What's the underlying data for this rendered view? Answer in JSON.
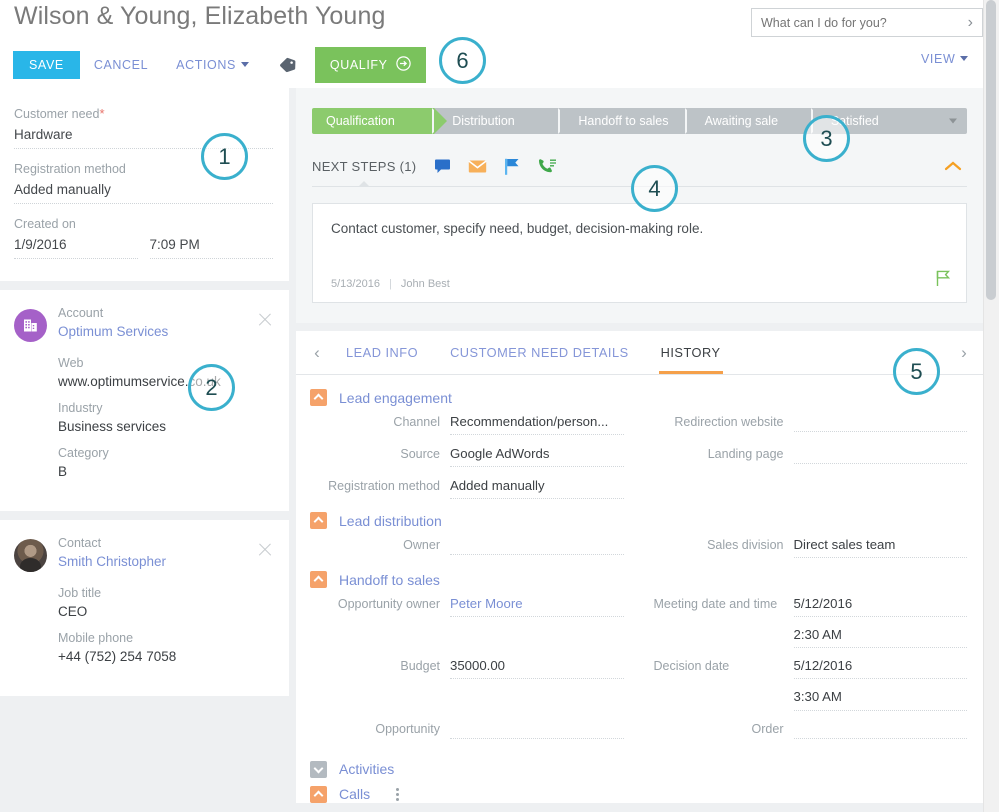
{
  "header": {
    "title": "Wilson & Young, Elizabeth Young",
    "save_label": "SAVE",
    "cancel_label": "CANCEL",
    "actions_label": "ACTIONS",
    "tag_icon": "tag-icon",
    "qualify_label": "QUALIFY",
    "view_label": "VIEW",
    "search_placeholder": "What can I do for you?",
    "search_value": ""
  },
  "left": {
    "need_card": {
      "customer_need_label": "Customer need",
      "customer_need_required": "*",
      "customer_need_value": "Hardware",
      "registration_method_label": "Registration method",
      "registration_method_value": "Added manually",
      "created_on_label": "Created on",
      "created_on_date": "1/9/2016",
      "created_on_time": "7:09 PM"
    },
    "account_card": {
      "label": "Account",
      "name": "Optimum Services",
      "icon": "building-icon",
      "close_icon": "close-icon",
      "fields": [
        {
          "label": "Web",
          "value": "www.optimumservice.co.uk"
        },
        {
          "label": "Industry",
          "value": "Business services"
        },
        {
          "label": "Category",
          "value": "B"
        }
      ]
    },
    "contact_card": {
      "label": "Contact",
      "name": "Smith Christopher",
      "icon": "avatar-photo",
      "close_icon": "close-icon",
      "fields": [
        {
          "label": "Job title",
          "value": "CEO"
        },
        {
          "label": "Mobile phone",
          "value": "+44 (752) 254 7058"
        }
      ]
    }
  },
  "stages": {
    "items": [
      {
        "label": "Qualification",
        "active": true
      },
      {
        "label": "Distribution",
        "active": false
      },
      {
        "label": "Handoff to sales",
        "active": false
      },
      {
        "label": "Awaiting sale",
        "active": false
      },
      {
        "label": "Satisfied",
        "active": false
      }
    ],
    "active_color": "#8ccb6d",
    "inactive_color": "#bdc3c7"
  },
  "next_steps": {
    "title": "NEXT STEPS (1)",
    "icons": [
      "comment-icon",
      "email-icon",
      "flag-icon",
      "call-icon"
    ],
    "collapse_icon": "chevron-up-icon",
    "card": {
      "text": "Contact customer, specify need, budget, decision-making role.",
      "date": "5/13/2016",
      "author": "John Best",
      "flag_icon": "flag-outline-icon"
    }
  },
  "tabs": {
    "prev_icon": "chevron-left-icon",
    "next_icon": "chevron-right-icon",
    "items": [
      {
        "label": "LEAD INFO",
        "active": false
      },
      {
        "label": "CUSTOMER NEED DETAILS",
        "active": false
      },
      {
        "label": "HISTORY",
        "active": true
      }
    ],
    "active_underline_color": "#f5a04a"
  },
  "sections": [
    {
      "id": "lead-engagement",
      "title": "Lead engagement",
      "toggle": "expanded",
      "toggle_color": "#f5a26a",
      "rows": [
        {
          "left_label": "Channel",
          "left_value": "Recommendation/person...",
          "left_link": false,
          "right_label": "Redirection website",
          "right_value": "",
          "right_link": false
        },
        {
          "left_label": "Source",
          "left_value": "Google AdWords",
          "left_link": false,
          "right_label": "Landing page",
          "right_value": "",
          "right_link": false
        },
        {
          "left_label": "Registration method",
          "left_value": "Added manually",
          "left_link": false,
          "right_label": "",
          "right_value": "",
          "right_link": false
        }
      ]
    },
    {
      "id": "lead-distribution",
      "title": "Lead distribution",
      "toggle": "expanded",
      "toggle_color": "#f5a26a",
      "rows": [
        {
          "left_label": "Owner",
          "left_value": "",
          "left_link": false,
          "right_label": "Sales division",
          "right_value": "Direct sales team",
          "right_link": false
        }
      ]
    },
    {
      "id": "handoff-to-sales",
      "title": "Handoff to sales",
      "toggle": "expanded",
      "toggle_color": "#f5a26a",
      "rows": [
        {
          "left_label": "Opportunity owner",
          "left_value": "Peter Moore",
          "left_link": true,
          "right_label": "Meeting date and time",
          "right_value": "5/12/2016",
          "right_value2": "2:30 AM",
          "right_link": false
        },
        {
          "left_label": "Budget",
          "left_value": "35000.00",
          "left_link": false,
          "right_label": "Decision date",
          "right_value": "5/12/2016",
          "right_value2": "3:30 AM",
          "right_link": false
        },
        {
          "left_label": "Opportunity",
          "left_value": "",
          "left_link": false,
          "right_label": "Order",
          "right_value": "",
          "right_link": false
        }
      ]
    }
  ],
  "bottom_sections": [
    {
      "id": "activities",
      "title": "Activities",
      "toggle": "collapsed",
      "toggle_color": "#b3bac0",
      "kebab": false
    },
    {
      "id": "calls",
      "title": "Calls",
      "toggle": "expanded",
      "toggle_color": "#f5a26a",
      "kebab": true
    }
  ],
  "callouts": [
    {
      "number": "1"
    },
    {
      "number": "2"
    },
    {
      "number": "3"
    },
    {
      "number": "4"
    },
    {
      "number": "5"
    },
    {
      "number": "6"
    }
  ]
}
